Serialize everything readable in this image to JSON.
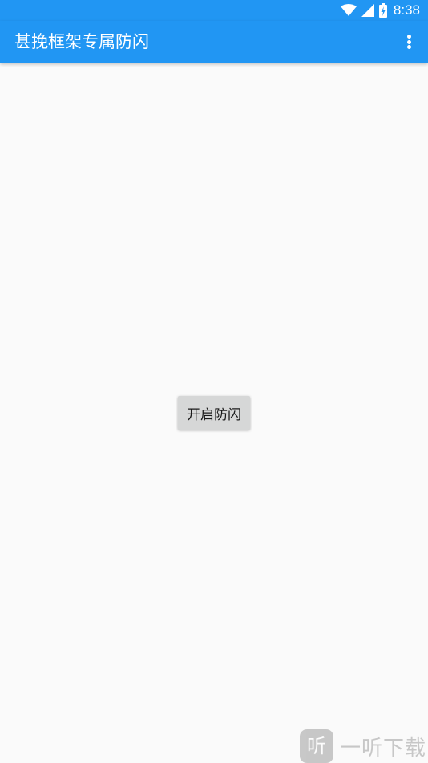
{
  "status_bar": {
    "time": "8:38",
    "icons": [
      "wifi-icon",
      "cell-signal-icon",
      "battery-charging-icon"
    ]
  },
  "app_bar": {
    "title": "甚挽框架专属防闪",
    "menu_icon": "more-vertical-icon"
  },
  "main": {
    "button_label": "开启防闪"
  },
  "watermark": {
    "logo_text": "听",
    "text": "一听下载"
  },
  "colors": {
    "primary": "#2196f3",
    "background": "#fafafa",
    "button": "#d6d7d7"
  }
}
